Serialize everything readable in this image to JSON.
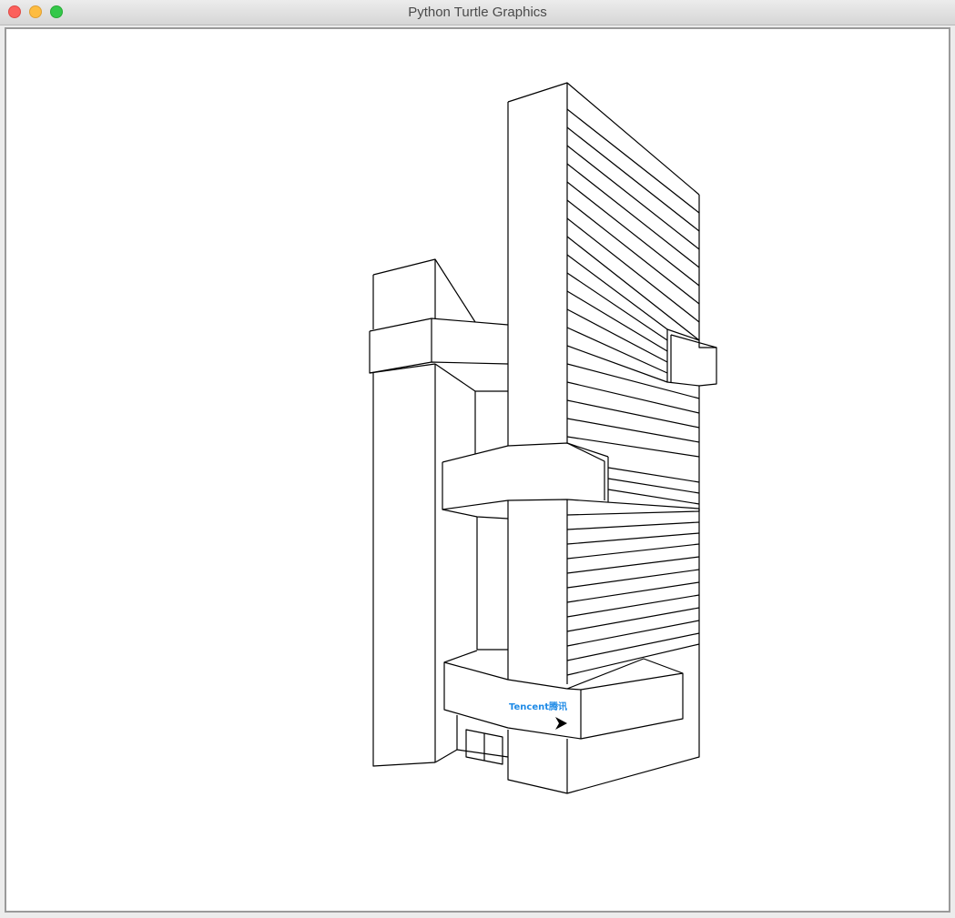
{
  "window": {
    "title": "Python Turtle Graphics"
  },
  "canvas": {
    "label_text": "Tencent腾讯",
    "label_color": "#1e8ae6",
    "stroke_color": "#000000",
    "background": "#ffffff",
    "turtle_icon": "turtle-arrow-icon"
  }
}
